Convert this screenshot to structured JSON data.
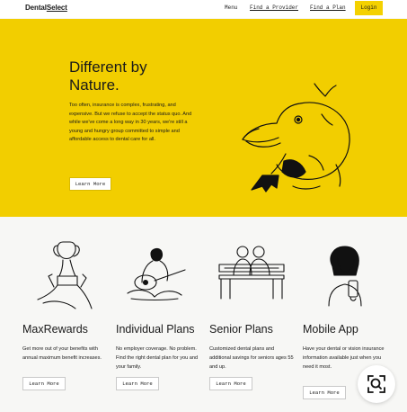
{
  "brand": {
    "logo_part1": "Dental",
    "logo_part2": "Select"
  },
  "nav": {
    "menu": "Menu",
    "find_provider": "Find a Provider",
    "find_plan": "Find a Plan",
    "login": "Login"
  },
  "colors": {
    "accent": "#f2ce00",
    "background": "#f7f7f5"
  },
  "hero": {
    "title": "Different by Nature.",
    "body": "Too often, insurance is complex, frustrating, and expensive. But we refuse to accept the status quo. And while we've come a long way in 30 years, we're still a young and hungry group committed to simple and affordable access to dental care for all.",
    "button": "Learn More",
    "illustration": "platypus-icon"
  },
  "cards": [
    {
      "title": "MaxRewards",
      "body": "Get more out of your benefits with annual maximum benefit increases.",
      "button": "Learn More",
      "illustration": "trophy-icon"
    },
    {
      "title": "Individual Plans",
      "body": "No employer coverage. No problem. Find the right dental plan for you and your family.",
      "button": "Learn More",
      "illustration": "guitar-player-icon"
    },
    {
      "title": "Senior Plans",
      "body": "Customized dental plans and additional savings for seniors ages 55 and up.",
      "button": "Learn More",
      "illustration": "bench-couple-icon"
    },
    {
      "title": "Mobile App",
      "body": "Have your dental or vision insurance information available just when you need it most.",
      "button": "Learn More",
      "illustration": "phone-user-icon"
    }
  ],
  "search_fab_icon": "search-icon"
}
